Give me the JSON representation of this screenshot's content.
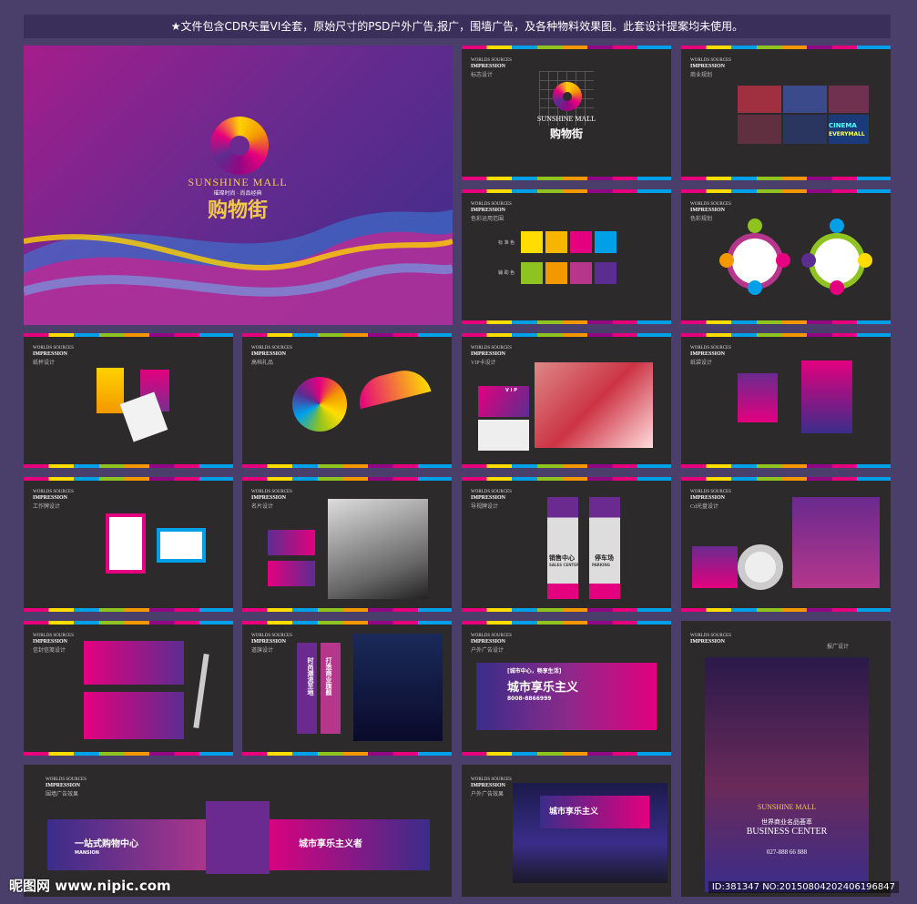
{
  "header": {
    "text": "★文件包含CDR矢量VI全套，原始尺寸的PSD户外广告,报广，围墙广告，及各种物料效果图。此套设计提案均未使用。"
  },
  "brand": {
    "name_en": "SUNSHINE MALL",
    "name_cn": "购物街",
    "tagline": "璀璨时尚 · 尚品经典"
  },
  "label": {
    "l1": "WORLDS SOURCES",
    "l2": "IMPRESSION"
  },
  "pages": {
    "p_logo": "标志设计",
    "p_biz": "商业规划",
    "p_color": "色彩运用范围",
    "p_color2": "色彩规划",
    "p_cup": "纸杯设计",
    "p_gift": "高档礼品",
    "p_vip": "VIP卡设计",
    "p_bag": "纸袋设计",
    "p_badge": "工作牌设计",
    "p_card": "名片设计",
    "p_guide": "导视牌设计",
    "p_cd": "Cd光盘设计",
    "p_env": "信封信笺设计",
    "p_flag": "道旗设计",
    "p_out1": "户外广告设计",
    "p_print": "报广设计",
    "p_wall": "围墙广告效果",
    "p_out2": "户外广告效果"
  },
  "swatch": {
    "std": "标 准 色",
    "aux": "辅 助 色"
  },
  "signs": {
    "sale": "销售中心",
    "sale_en": "SALES CENTER",
    "park": "停车场",
    "park_en": "PARKING"
  },
  "ads": {
    "city": "城市享乐主义",
    "slogan": "[城市中心，畅享生活]",
    "phone": "8008-8866999",
    "flag1": "时尚潮流至地",
    "flag2": "打造商业旗舰",
    "wall1": "一站式购物中心",
    "wall2": "城市享乐主义者",
    "mansion": "MANSION",
    "bc_cn": "世界商业名品荟萃",
    "bc_en": "BUSINESS CENTER",
    "bc_tel": "027-888 66 888",
    "cinema": "CINEMA",
    "everymall": "EVERYMALL",
    "vip": "V I P"
  },
  "watermark": {
    "logo": "昵图网 www.nipic.com",
    "id": "ID:381347 NO:20150804202406196847"
  },
  "colors": {
    "std": [
      "#ffdd00",
      "#f7b500",
      "#e4007f",
      "#00a0e9"
    ],
    "aux": [
      "#8fc31f",
      "#f39800",
      "#b5368b",
      "#5b2d90"
    ]
  }
}
